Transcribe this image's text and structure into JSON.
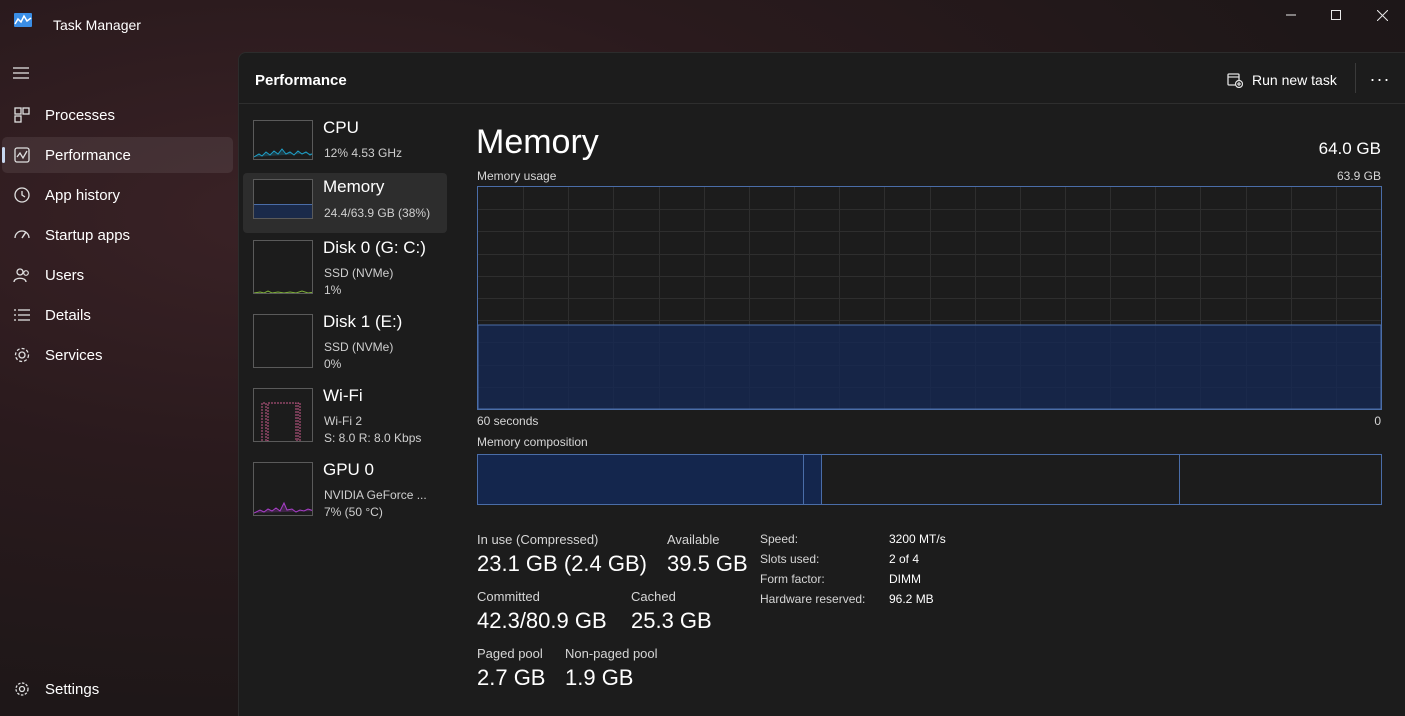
{
  "window": {
    "title": "Task Manager",
    "icon": "task-manager-icon",
    "controls": [
      "minimize-icon",
      "maximize-icon",
      "close-icon"
    ]
  },
  "sidebar": {
    "items": [
      {
        "label": "Processes",
        "icon": "processes-icon"
      },
      {
        "label": "Performance",
        "icon": "performance-icon",
        "active": true
      },
      {
        "label": "App history",
        "icon": "app-history-icon"
      },
      {
        "label": "Startup apps",
        "icon": "startup-apps-icon"
      },
      {
        "label": "Users",
        "icon": "users-icon"
      },
      {
        "label": "Details",
        "icon": "details-icon"
      },
      {
        "label": "Services",
        "icon": "services-icon"
      }
    ],
    "settings": {
      "label": "Settings",
      "icon": "settings-icon"
    }
  },
  "header": {
    "title": "Performance",
    "run_new_task": "Run new task",
    "more": "···"
  },
  "resources": [
    {
      "name": "CPU",
      "line1": "12%  4.53 GHz",
      "line2": "",
      "color": "#1fa0c8"
    },
    {
      "name": "Memory",
      "line1": "24.4/63.9 GB (38%)",
      "line2": "",
      "color": "#4a6da8",
      "active": true
    },
    {
      "name": "Disk 0 (G: C:)",
      "line1": "SSD (NVMe)",
      "line2": "1%",
      "color": "#7fb23a"
    },
    {
      "name": "Disk 1 (E:)",
      "line1": "SSD (NVMe)",
      "line2": "0%",
      "color": "#7fb23a"
    },
    {
      "name": "Wi-Fi",
      "line1": "Wi-Fi 2",
      "line2": "S: 8.0  R: 8.0 Kbps",
      "color": "#c85a8a"
    },
    {
      "name": "GPU 0",
      "line1": "NVIDIA GeForce ...",
      "line2": "7%  (50 °C)",
      "color": "#a83ec8"
    }
  ],
  "memory": {
    "title": "Memory",
    "total": "64.0 GB",
    "usage_label": "Memory usage",
    "usage_max": "63.9 GB",
    "time_left": "60 seconds",
    "time_right": "0",
    "composition_label": "Memory composition",
    "usage_fraction": 0.38,
    "composition": {
      "in_use": 23.1,
      "modified": 1.3,
      "standby": 25.3,
      "free": 14.2
    },
    "stats": {
      "in_use_label": "In use (Compressed)",
      "in_use_value": "23.1 GB (2.4 GB)",
      "available_label": "Available",
      "available_value": "39.5 GB",
      "committed_label": "Committed",
      "committed_value": "42.3/80.9 GB",
      "cached_label": "Cached",
      "cached_value": "25.3 GB",
      "paged_label": "Paged pool",
      "paged_value": "2.7 GB",
      "nonpaged_label": "Non-paged pool",
      "nonpaged_value": "1.9 GB"
    },
    "specs": [
      {
        "key": "Speed:",
        "value": "3200 MT/s"
      },
      {
        "key": "Slots used:",
        "value": "2 of 4"
      },
      {
        "key": "Form factor:",
        "value": "DIMM"
      },
      {
        "key": "Hardware reserved:",
        "value": "96.2 MB"
      }
    ]
  }
}
